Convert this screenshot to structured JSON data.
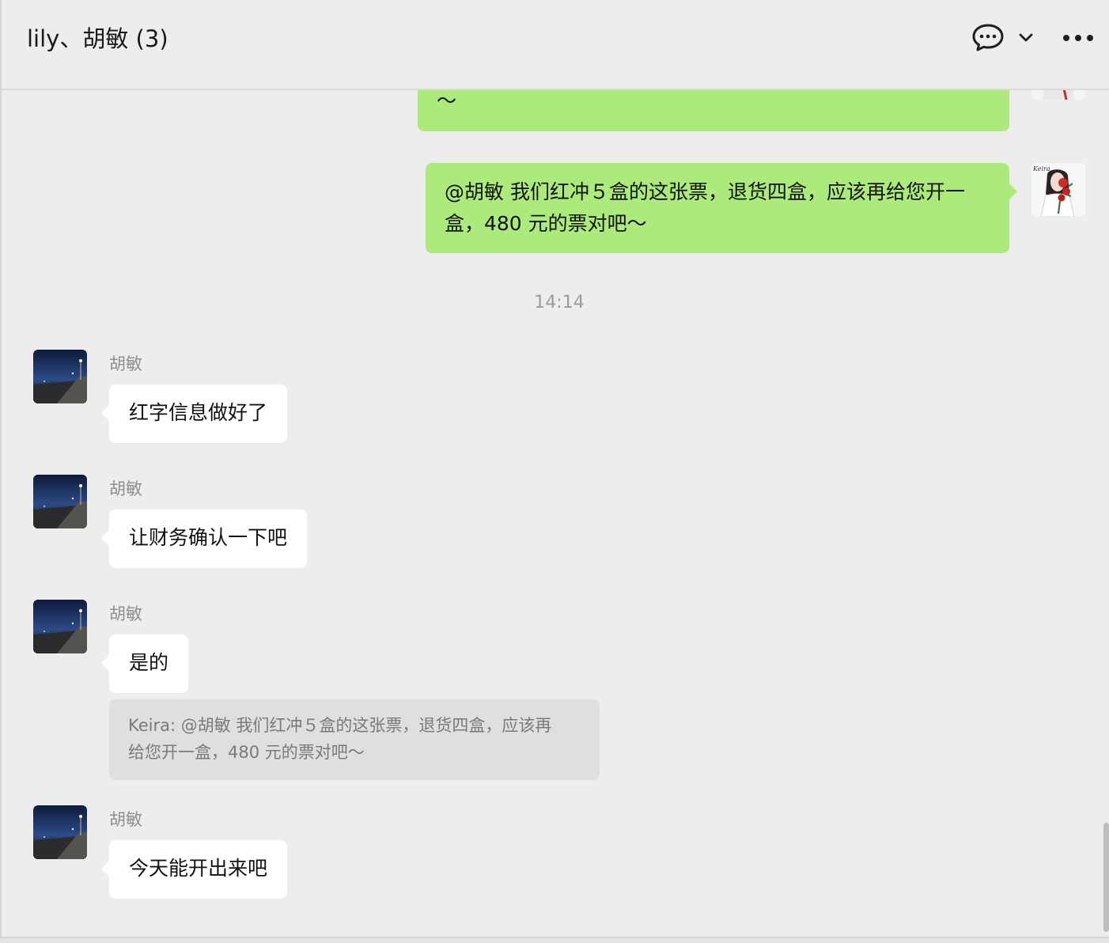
{
  "header": {
    "title": "lily、胡敏 (3)",
    "icons": [
      "chat-bubble-icon",
      "chevron-down-icon",
      "more-icon"
    ]
  },
  "messages": {
    "partial_outgoing": {
      "text": "～",
      "sender": "Keira"
    },
    "outgoing": {
      "sender": "Keira",
      "lines": [
        "@胡敏 我们红冲５盒的这张票，退货四盒，应该再给您开一",
        "盒，480 元的票对吧～"
      ],
      "bubble_color": "#aceb7b"
    },
    "timestamp": "14:14",
    "incoming": [
      {
        "sender": "胡敏",
        "text": "红字信息做好了"
      },
      {
        "sender": "胡敏",
        "text": "让财务确认一下吧"
      },
      {
        "sender": "胡敏",
        "text": "是的",
        "quote_lines": [
          "Keira: @胡敏 我们红冲５盒的这张票，退货四盒，应该再",
          "给您开一盒，480 元的票对吧～"
        ]
      },
      {
        "sender": "胡敏",
        "text": "今天能开出来吧"
      }
    ],
    "avatar_text": "Keira"
  },
  "colors": {
    "background": "#ededed",
    "outgoing_bubble": "#aceb7b",
    "incoming_bubble": "#ffffff",
    "quote_background": "#dfdfdf",
    "meta_text": "#8f8f8f"
  }
}
